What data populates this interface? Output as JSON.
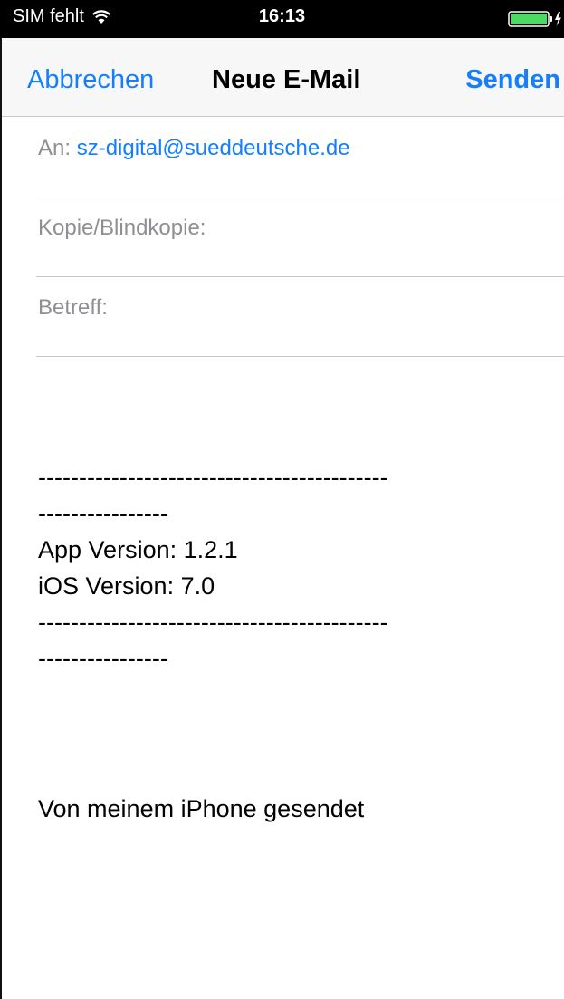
{
  "status_bar": {
    "carrier": "SIM fehlt",
    "time": "16:13",
    "icons": [
      "wifi-icon",
      "battery-charging-icon"
    ]
  },
  "nav": {
    "cancel_label": "Abbrechen",
    "title": "Neue E-Mail",
    "send_label": "Senden"
  },
  "fields": {
    "to_label": "An:",
    "to_value": "sz-digital@sueddeutsche.de",
    "cc_label": "Kopie/Blindkopie:",
    "subject_label": "Betreff:"
  },
  "body": {
    "lines": [
      "-------------------------------------------",
      "----------------",
      "App Version: 1.2.1",
      "iOS Version: 7.0",
      "-------------------------------------------",
      "----------------"
    ],
    "signature": "Von meinem iPhone gesendet"
  },
  "colors": {
    "accent": "#147efb",
    "placeholder": "#8e8e93",
    "separator": "#c8c7cc",
    "battery": "#4cd964"
  }
}
